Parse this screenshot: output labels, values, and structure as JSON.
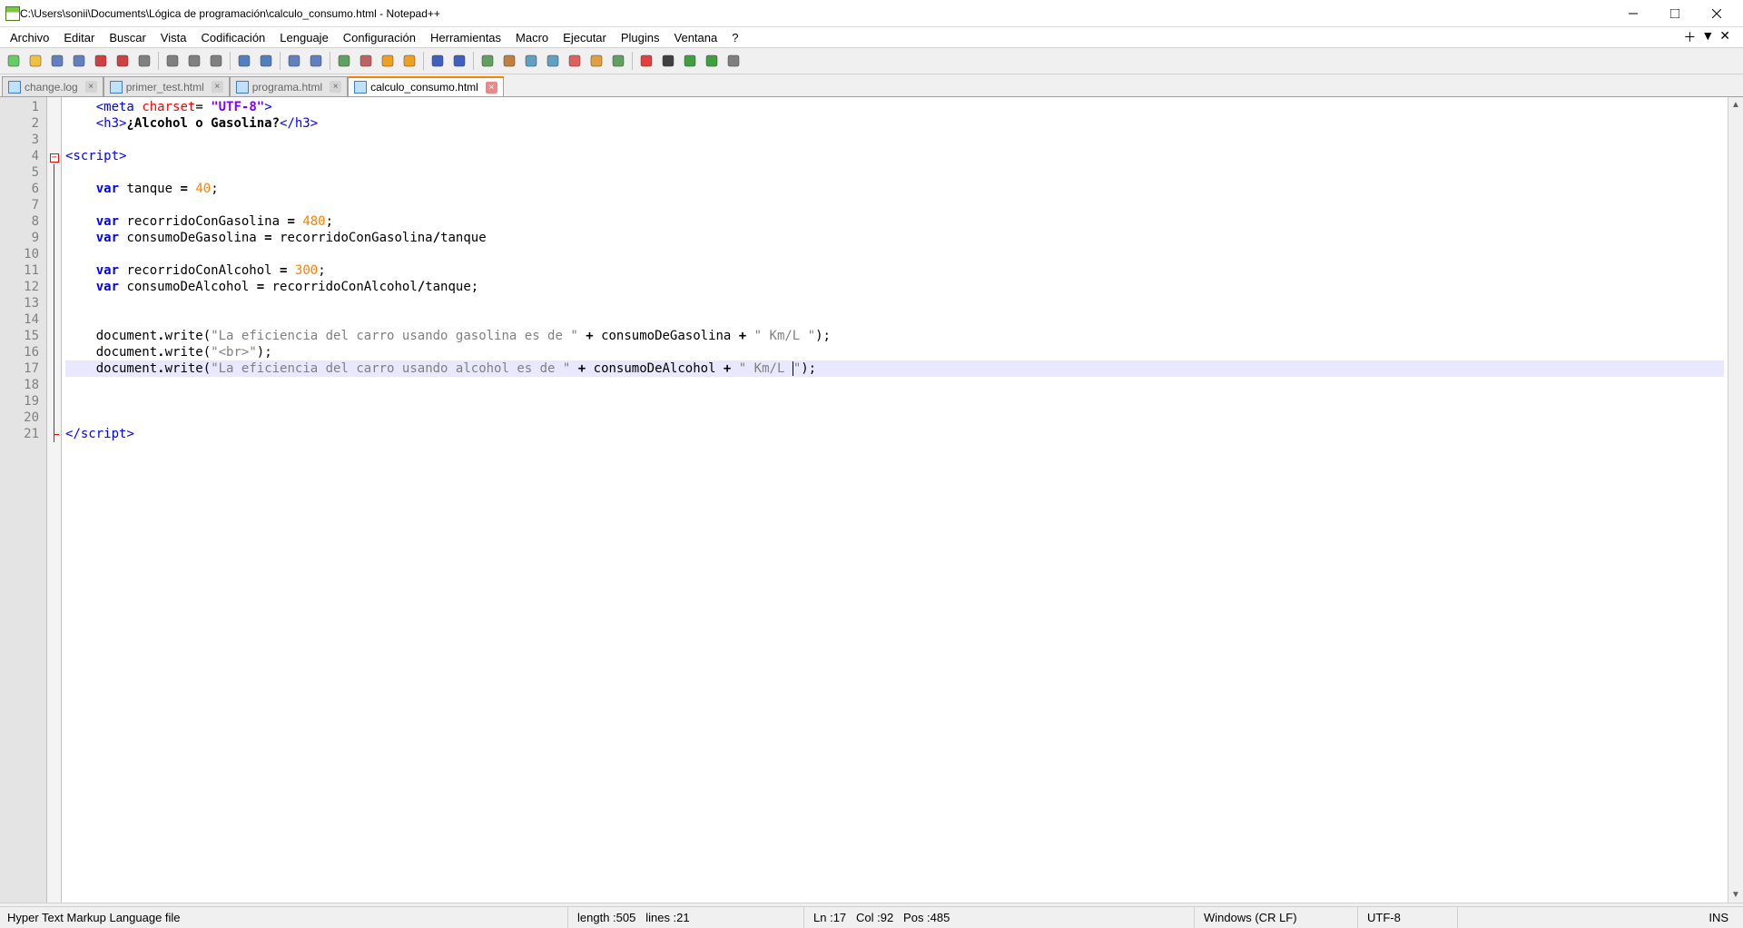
{
  "title_bar": {
    "path": "C:\\Users\\sonii\\Documents\\Lógica de programación\\calculo_consumo.html - Notepad++"
  },
  "menu": {
    "items": [
      "Archivo",
      "Editar",
      "Buscar",
      "Vista",
      "Codificación",
      "Lenguaje",
      "Configuración",
      "Herramientas",
      "Macro",
      "Ejecutar",
      "Plugins",
      "Ventana",
      "?"
    ]
  },
  "toolbar_icons": [
    "new-file",
    "open-file",
    "save",
    "save-all",
    "close",
    "close-all",
    "print",
    "sep",
    "cut",
    "copy",
    "paste",
    "sep",
    "undo",
    "redo",
    "sep",
    "find",
    "replace",
    "sep",
    "zoom-in",
    "zoom-out",
    "sync-v",
    "sync-h",
    "sep",
    "word-wrap",
    "show-all-chars",
    "sep",
    "indent-guide",
    "lang",
    "doc-map",
    "doc-list",
    "func-list",
    "folder-workspace",
    "monitor",
    "sep",
    "record-macro",
    "stop-macro",
    "play-macro",
    "fast-macro",
    "save-macro"
  ],
  "tabs": [
    {
      "label": "change.log",
      "active": false
    },
    {
      "label": "primer_test.html",
      "active": false
    },
    {
      "label": "programa.html",
      "active": false
    },
    {
      "label": "calculo_consumo.html",
      "active": true
    }
  ],
  "editor": {
    "line_count": 21,
    "current_line": 17,
    "fold_start": 4,
    "fold_end": 21,
    "cursor_col": 92
  },
  "code": {
    "tokens": [
      {
        "n": 1,
        "seg": [
          {
            "t": "    ",
            "c": ""
          },
          {
            "t": "<meta",
            "c": "tok-tag"
          },
          {
            "t": " ",
            "c": ""
          },
          {
            "t": "charset",
            "c": "tok-attr"
          },
          {
            "t": "= ",
            "c": "tok-punct"
          },
          {
            "t": "\"UTF-8\"",
            "c": "tok-str",
            "bold": true,
            "color": "#8000ff"
          },
          {
            "t": ">",
            "c": "tok-tag"
          }
        ]
      },
      {
        "n": 2,
        "seg": [
          {
            "t": "    ",
            "c": ""
          },
          {
            "t": "<h3>",
            "c": "tok-tag"
          },
          {
            "t": "¿Alcohol o Gasolina?",
            "c": "tok-text"
          },
          {
            "t": "</h3>",
            "c": "tok-tag"
          }
        ]
      },
      {
        "n": 3,
        "seg": []
      },
      {
        "n": 4,
        "seg": [
          {
            "t": "<script>",
            "c": "tok-tag"
          }
        ]
      },
      {
        "n": 5,
        "seg": []
      },
      {
        "n": 6,
        "seg": [
          {
            "t": "    ",
            "c": ""
          },
          {
            "t": "var",
            "c": "tok-kw"
          },
          {
            "t": " tanque ",
            "c": "tok-ident"
          },
          {
            "t": "=",
            "c": "tok-op"
          },
          {
            "t": " ",
            "c": ""
          },
          {
            "t": "40",
            "c": "tok-num"
          },
          {
            "t": ";",
            "c": "tok-punct"
          }
        ]
      },
      {
        "n": 7,
        "seg": []
      },
      {
        "n": 8,
        "seg": [
          {
            "t": "    ",
            "c": ""
          },
          {
            "t": "var",
            "c": "tok-kw"
          },
          {
            "t": " recorridoConGasolina ",
            "c": "tok-ident"
          },
          {
            "t": "=",
            "c": "tok-op"
          },
          {
            "t": " ",
            "c": ""
          },
          {
            "t": "480",
            "c": "tok-num"
          },
          {
            "t": ";",
            "c": "tok-punct"
          }
        ]
      },
      {
        "n": 9,
        "seg": [
          {
            "t": "    ",
            "c": ""
          },
          {
            "t": "var",
            "c": "tok-kw"
          },
          {
            "t": " consumoDeGasolina ",
            "c": "tok-ident"
          },
          {
            "t": "=",
            "c": "tok-op"
          },
          {
            "t": " recorridoConGasolina",
            "c": "tok-ident"
          },
          {
            "t": "/",
            "c": "tok-op"
          },
          {
            "t": "tanque",
            "c": "tok-ident"
          }
        ]
      },
      {
        "n": 10,
        "seg": []
      },
      {
        "n": 11,
        "seg": [
          {
            "t": "    ",
            "c": ""
          },
          {
            "t": "var",
            "c": "tok-kw"
          },
          {
            "t": " recorridoConAlcohol ",
            "c": "tok-ident"
          },
          {
            "t": "=",
            "c": "tok-op"
          },
          {
            "t": " ",
            "c": ""
          },
          {
            "t": "300",
            "c": "tok-num"
          },
          {
            "t": ";",
            "c": "tok-punct"
          }
        ]
      },
      {
        "n": 12,
        "seg": [
          {
            "t": "    ",
            "c": ""
          },
          {
            "t": "var",
            "c": "tok-kw"
          },
          {
            "t": " consumoDeAlcohol ",
            "c": "tok-ident"
          },
          {
            "t": "=",
            "c": "tok-op"
          },
          {
            "t": " recorridoConAlcohol",
            "c": "tok-ident"
          },
          {
            "t": "/",
            "c": "tok-op"
          },
          {
            "t": "tanque",
            "c": "tok-ident"
          },
          {
            "t": ";",
            "c": "tok-punct"
          }
        ]
      },
      {
        "n": 13,
        "seg": []
      },
      {
        "n": 14,
        "seg": []
      },
      {
        "n": 15,
        "seg": [
          {
            "t": "    document",
            "c": "tok-ident"
          },
          {
            "t": ".",
            "c": "tok-op"
          },
          {
            "t": "write",
            "c": "tok-ident"
          },
          {
            "t": "(",
            "c": "tok-punct"
          },
          {
            "t": "\"La eficiencia del carro usando gasolina es de \"",
            "c": "tok-str"
          },
          {
            "t": " + ",
            "c": "tok-op"
          },
          {
            "t": "consumoDeGasolina",
            "c": "tok-ident"
          },
          {
            "t": " + ",
            "c": "tok-op"
          },
          {
            "t": "\" Km/L \"",
            "c": "tok-str"
          },
          {
            "t": ");",
            "c": "tok-punct"
          }
        ]
      },
      {
        "n": 16,
        "seg": [
          {
            "t": "    document",
            "c": "tok-ident"
          },
          {
            "t": ".",
            "c": "tok-op"
          },
          {
            "t": "write",
            "c": "tok-ident"
          },
          {
            "t": "(",
            "c": "tok-punct"
          },
          {
            "t": "\"<br>\"",
            "c": "tok-str"
          },
          {
            "t": ");",
            "c": "tok-punct"
          }
        ]
      },
      {
        "n": 17,
        "seg": [
          {
            "t": "    document",
            "c": "tok-ident"
          },
          {
            "t": ".",
            "c": "tok-op"
          },
          {
            "t": "write",
            "c": "tok-ident"
          },
          {
            "t": "(",
            "c": "tok-punct"
          },
          {
            "t": "\"La eficiencia del carro usando alcohol es de \"",
            "c": "tok-str"
          },
          {
            "t": " + ",
            "c": "tok-op"
          },
          {
            "t": "consumoDeAlcohol",
            "c": "tok-ident"
          },
          {
            "t": " + ",
            "c": "tok-op"
          },
          {
            "t": "\" Km/L ",
            "c": "tok-str"
          },
          {
            "t": "|",
            "c": "",
            "caret": true
          },
          {
            "t": "\"",
            "c": "tok-str"
          },
          {
            "t": ");",
            "c": "tok-punct"
          }
        ]
      },
      {
        "n": 18,
        "seg": []
      },
      {
        "n": 19,
        "seg": []
      },
      {
        "n": 20,
        "seg": []
      },
      {
        "n": 21,
        "seg": [
          {
            "t": "<",
            "c": "tok-tag"
          },
          {
            "t": "/script",
            "c": "tok-tag"
          },
          {
            "t": ">",
            "c": "tok-tag"
          }
        ]
      }
    ]
  },
  "status": {
    "filetype": "Hyper Text Markup Language file",
    "length_label": "length : ",
    "length_val": "505",
    "lines_label": "lines : ",
    "lines_val": "21",
    "ln_label": "Ln : ",
    "ln_val": "17",
    "col_label": "Col : ",
    "col_val": "92",
    "pos_label": "Pos : ",
    "pos_val": "485",
    "eol": "Windows (CR LF)",
    "encoding": "UTF-8",
    "mode": "INS"
  },
  "tb_colors": {
    "new-file": "#66cc66",
    "open-file": "#f0c040",
    "save": "#6080c0",
    "save-all": "#6080c0",
    "close": "#d04040",
    "close-all": "#d04040",
    "print": "#808080",
    "cut": "#808080",
    "copy": "#808080",
    "paste": "#808080",
    "undo": "#5080c0",
    "redo": "#5080c0",
    "find": "#6080c0",
    "replace": "#6080c0",
    "zoom-in": "#60a060",
    "zoom-out": "#c06060",
    "sync-v": "#f0a020",
    "sync-h": "#f0a020",
    "word-wrap": "#4060c0",
    "show-all-chars": "#4060c0",
    "indent-guide": "#60a060",
    "lang": "#c08040",
    "doc-map": "#60a0c0",
    "doc-list": "#60a0c0",
    "func-list": "#e06060",
    "folder-workspace": "#e0a040",
    "monitor": "#60a060",
    "record-macro": "#e04040",
    "stop-macro": "#404040",
    "play-macro": "#40a040",
    "fast-macro": "#40a040",
    "save-macro": "#808080"
  }
}
